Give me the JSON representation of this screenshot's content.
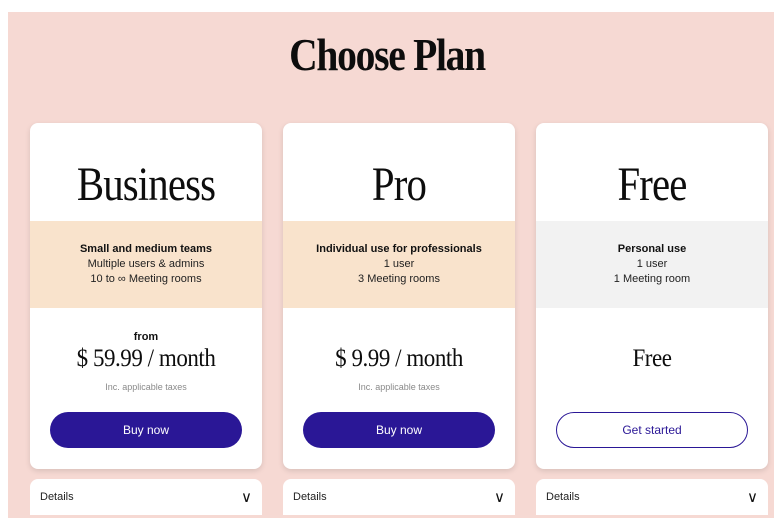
{
  "title": "Choose Plan",
  "colors": {
    "page_background": "#f6d9d3",
    "accent": "#2a1796",
    "band_warm": "#f9e3cc",
    "band_gray": "#f2f2f2"
  },
  "plans": [
    {
      "name": "Business",
      "audience": "Small and medium teams",
      "users": "Multiple users & admins",
      "rooms": "10 to ∞ Meeting rooms",
      "price_prefix": "from",
      "price": "$ 59.99 / month",
      "tax_note": "Inc. applicable taxes",
      "button": "Buy now",
      "details_label": "Details",
      "details_icon": "chevron-down-icon"
    },
    {
      "name": "Pro",
      "audience": "Individual use for professionals",
      "users": "1 user",
      "rooms": "3 Meeting rooms",
      "price": "$ 9.99 / month",
      "tax_note": "Inc. applicable taxes",
      "button": "Buy now",
      "details_label": "Details",
      "details_icon": "chevron-down-icon"
    },
    {
      "name": "Free",
      "audience": "Personal use",
      "users": "1 user",
      "rooms": "1 Meeting room",
      "price": "Free",
      "button": "Get started",
      "details_label": "Details",
      "details_icon": "chevron-down-icon"
    }
  ]
}
